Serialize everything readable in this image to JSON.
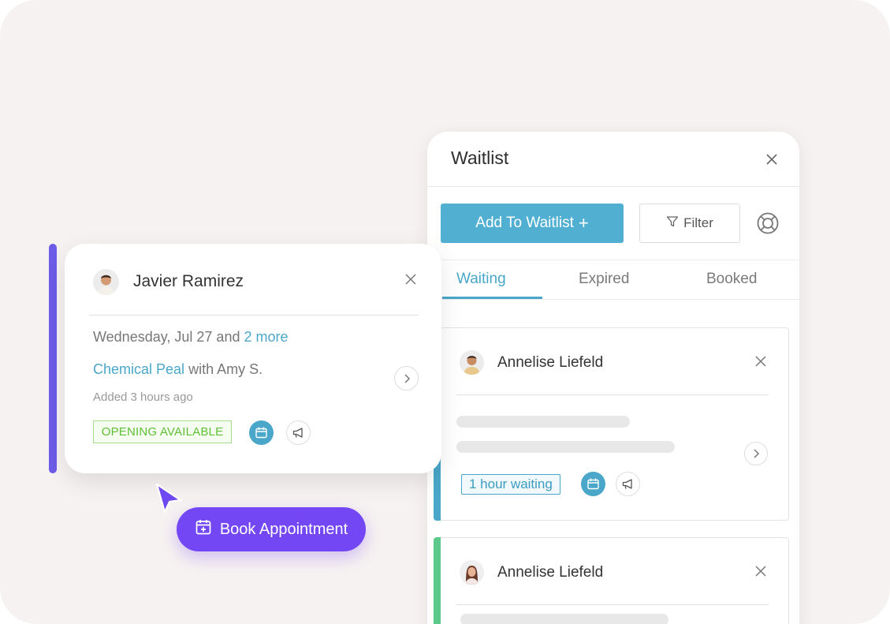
{
  "waitlist": {
    "title": "Waitlist",
    "add_button_label": "Add To Waitlist",
    "add_button_symbol": "+",
    "filter_label": "Filter",
    "tabs": [
      {
        "label": "Waiting",
        "active": true
      },
      {
        "label": "Expired",
        "active": false
      },
      {
        "label": "Booked",
        "active": false
      }
    ],
    "entries": [
      {
        "name": "Annelise Liefeld",
        "badge": "1 hour waiting",
        "accent_color": "#4aa7c9"
      },
      {
        "name": "Annelise Liefeld",
        "accent_color": "#5cc98a"
      }
    ]
  },
  "detail": {
    "name": "Javier Ramirez",
    "date_text": "Wednesday, Jul 27 and",
    "date_more": "2 more",
    "service": "Chemical Peal",
    "provider_text": "with Amy S.",
    "added": "Added 3 hours ago",
    "status": "OPENING AVAILABLE",
    "accent_color": "#6c5ce7"
  },
  "book_button_label": "Book Appointment",
  "colors": {
    "primary": "#51afd1",
    "accent_purple": "#7447f5",
    "status_green": "#5fbf36"
  }
}
